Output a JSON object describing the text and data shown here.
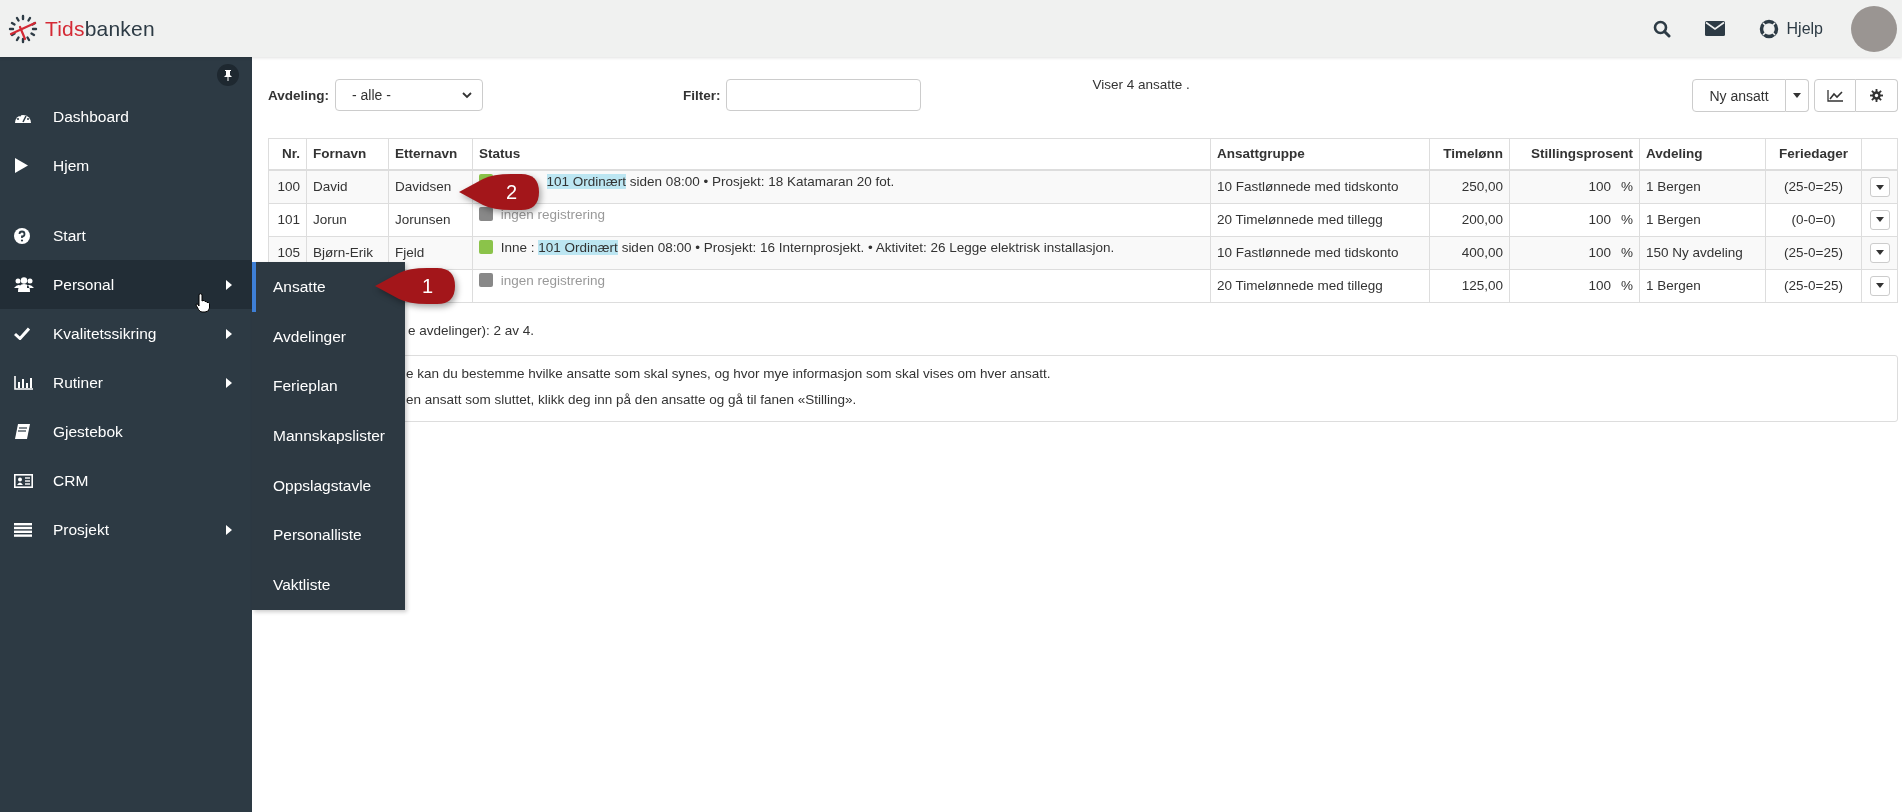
{
  "brand": {
    "first": "Tids",
    "second": "banken"
  },
  "topbar": {
    "help": "Hjelp"
  },
  "sidebar": {
    "items": [
      {
        "label": "Dashboard",
        "submenu": false,
        "selected": false,
        "separated": false
      },
      {
        "label": "Hjem",
        "submenu": false,
        "selected": false,
        "separated": false
      },
      {
        "label": "Start",
        "submenu": false,
        "selected": false,
        "separated": true
      },
      {
        "label": "Personal",
        "submenu": true,
        "selected": true,
        "separated": false
      },
      {
        "label": "Kvalitetssikring",
        "submenu": true,
        "selected": false,
        "separated": false
      },
      {
        "label": "Rutiner",
        "submenu": true,
        "selected": false,
        "separated": false
      },
      {
        "label": "Gjestebok",
        "submenu": false,
        "selected": false,
        "separated": false
      },
      {
        "label": "CRM",
        "submenu": false,
        "selected": false,
        "separated": false
      },
      {
        "label": "Prosjekt",
        "submenu": true,
        "selected": false,
        "separated": false
      }
    ]
  },
  "submenu": {
    "items": [
      {
        "label": "Ansatte",
        "selected": true
      },
      {
        "label": "Avdelinger",
        "selected": false
      },
      {
        "label": "Ferieplan",
        "selected": false
      },
      {
        "label": "Mannskapslister",
        "selected": false
      },
      {
        "label": "Oppslagstavle",
        "selected": false
      },
      {
        "label": "Personalliste",
        "selected": false
      },
      {
        "label": "Vaktliste",
        "selected": false
      }
    ]
  },
  "toolbar": {
    "department_label": "Avdeling:",
    "department_value": "- alle -",
    "filter_label": "Filter:",
    "count_text": "Viser 4 ansatte .",
    "new_button": "Ny ansatt"
  },
  "table": {
    "columns": [
      "Nr.",
      "Fornavn",
      "Etternavn",
      "Status",
      "Ansattgruppe",
      "Timelønn",
      "Stillingsprosent",
      "Avdeling",
      "Feriedager"
    ],
    "rows": [
      {
        "nr": "100",
        "first_name": "David",
        "last_name": "Davidsen",
        "status": {
          "kind": "active",
          "color": "#8bc34a",
          "code": "101 Ordinært",
          "text": "siden 08:00 • Prosjekt: 18 Katamaran 20 fot."
        },
        "group": "10 Fastlønnede med tidskonto",
        "wage": "250,00",
        "percent": "100",
        "percent_unit": "%",
        "department": "1 Bergen",
        "holidays": "(25-0=25)"
      },
      {
        "nr": "101",
        "first_name": "Jorun",
        "last_name": "Jorunsen",
        "status": {
          "kind": "none",
          "color": "#888888",
          "text": "ingen registrering"
        },
        "group": "20 Timelønnede med tillegg",
        "wage": "200,00",
        "percent": "100",
        "percent_unit": "%",
        "department": "1 Bergen",
        "holidays": "(0-0=0)"
      },
      {
        "nr": "105",
        "first_name": "Bjørn-Erik",
        "last_name": "Fjeld",
        "status": {
          "kind": "active",
          "color": "#8bc34a",
          "prefix": "Inne :",
          "code": "101 Ordinært",
          "text": "siden 08:00 • Prosjekt: 16 Internprosjekt. • Aktivitet: 26 Legge elektrisk installasjon."
        },
        "group": "10 Fastlønnede med tidskonto",
        "wage": "400,00",
        "percent": "100",
        "percent_unit": "%",
        "department": "150 Ny avdeling",
        "holidays": "(25-0=25)"
      },
      {
        "status": {
          "kind": "none",
          "color": "#888888",
          "text": "ingen registrering"
        },
        "group": "20 Timelønnede med tillegg",
        "wage": "125,00",
        "percent": "100",
        "percent_unit": "%",
        "department": "1 Bergen",
        "holidays": "(25-0=25)"
      }
    ]
  },
  "summary": "e avdelinger): 2 av 4.",
  "info_lines": [
    "e kan du bestemme hvilke ansatte som skal synes, og hvor mye informasjon som skal vises om hver ansatt.",
    "en ansatt som sluttet, klikk deg inn på den ansatte og gå til fanen «Stilling»."
  ],
  "callouts": [
    {
      "number": "1"
    },
    {
      "number": "2"
    }
  ]
}
